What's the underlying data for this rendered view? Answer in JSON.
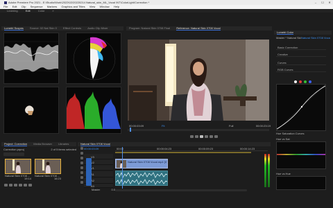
{
  "window": {
    "title": "Adobe Premiere Pro 2021 - E:\\Studio\\Work\\2022\\02\\20220214 Natural_skin_ML_Vocal \\NT\\ColorLight\\Correction *",
    "controls": [
      "–",
      "☐",
      "✕"
    ]
  },
  "menu": [
    "File",
    "Edit",
    "Clip",
    "Sequence",
    "Markers",
    "Graphics and Titles",
    "View",
    "Window",
    "Help"
  ],
  "workspace_tabs": [
    {
      "label": "Learning",
      "active": false
    },
    {
      "label": "Edit",
      "active": true
    },
    {
      "label": "Color",
      "active": false
    },
    {
      "label": "»",
      "active": false
    }
  ],
  "scopes_panel": {
    "tabs": [
      "Lumetri Scopes",
      "Source: 02 Nat Skin 0",
      "Effect Controls",
      "Audio Clip Mixer",
      "≡"
    ],
    "active_tab": "Lumetri Scopes"
  },
  "program_panel": {
    "tabs": [
      "Program: Natural Skin 0708 Final",
      "Reference: Natural Skin 0708 Vocal",
      "≡"
    ],
    "active_tab": "Reference: Natural Skin 0708 Vocal",
    "timecode_left": "00:00:03:09",
    "timecode_right": "00:00:23:19",
    "fit_label": "Fit",
    "quality_label": "Full"
  },
  "lumetri_panel": {
    "tabs": [
      "Lumetri Color",
      "≡"
    ],
    "source_label": "Master * Natural Skin",
    "clip_label": "Natural Skin 0708 Vocal",
    "sections": [
      {
        "label": "Basic Correction",
        "checked": true
      },
      {
        "label": "Creative",
        "checked": true
      },
      {
        "label": "Curves",
        "checked": true
      },
      {
        "label": "RGB Curves",
        "checked": true
      }
    ],
    "hue_section": "Hue Saturation Curves",
    "hue_sub_a": "Hue vs Sat",
    "hue_sub_b": "Hue vs Hue"
  },
  "project_panel": {
    "tabs": [
      "Project: Correction",
      "Media Browser",
      "Libraries",
      "≡"
    ],
    "file_name": "Correction.prproj",
    "item_count": "2 of 5 items selected",
    "items": [
      {
        "name": "Natural Skin 0708 ...",
        "duration": "19:14"
      },
      {
        "name": "Natural Skin 0708 ...",
        "duration": "16:23"
      }
    ]
  },
  "timeline_panel": {
    "tabs": [
      "Natural Skin 0708 Vocal",
      "≡"
    ],
    "timecode": "00:00:03:09",
    "ruler_marks": [
      "00:00",
      "00:00:04:23",
      "00:00:09:23",
      "00:00:14:23"
    ],
    "tracks": [
      {
        "name": "V3",
        "type": "video"
      },
      {
        "name": "V2",
        "type": "video"
      },
      {
        "name": "V1",
        "type": "video"
      },
      {
        "name": "A1",
        "type": "audio"
      },
      {
        "name": "A2",
        "type": "audio"
      },
      {
        "name": "A3",
        "type": "audio"
      }
    ],
    "video_clip_label": "Natural Skin 0708 Vocal.mp4 [V]",
    "master_label": "Master",
    "master_value": "0.0"
  },
  "colors": {
    "accent_blue": "#3a8ef0",
    "playhead": "#4f8fe8",
    "clip_video": "#7d9bd6",
    "clip_audio": "#2f7180",
    "curve_white": "#ffffff",
    "curve_red": "#e23a3a",
    "curve_green": "#37c037",
    "curve_blue": "#3a5ff0"
  }
}
